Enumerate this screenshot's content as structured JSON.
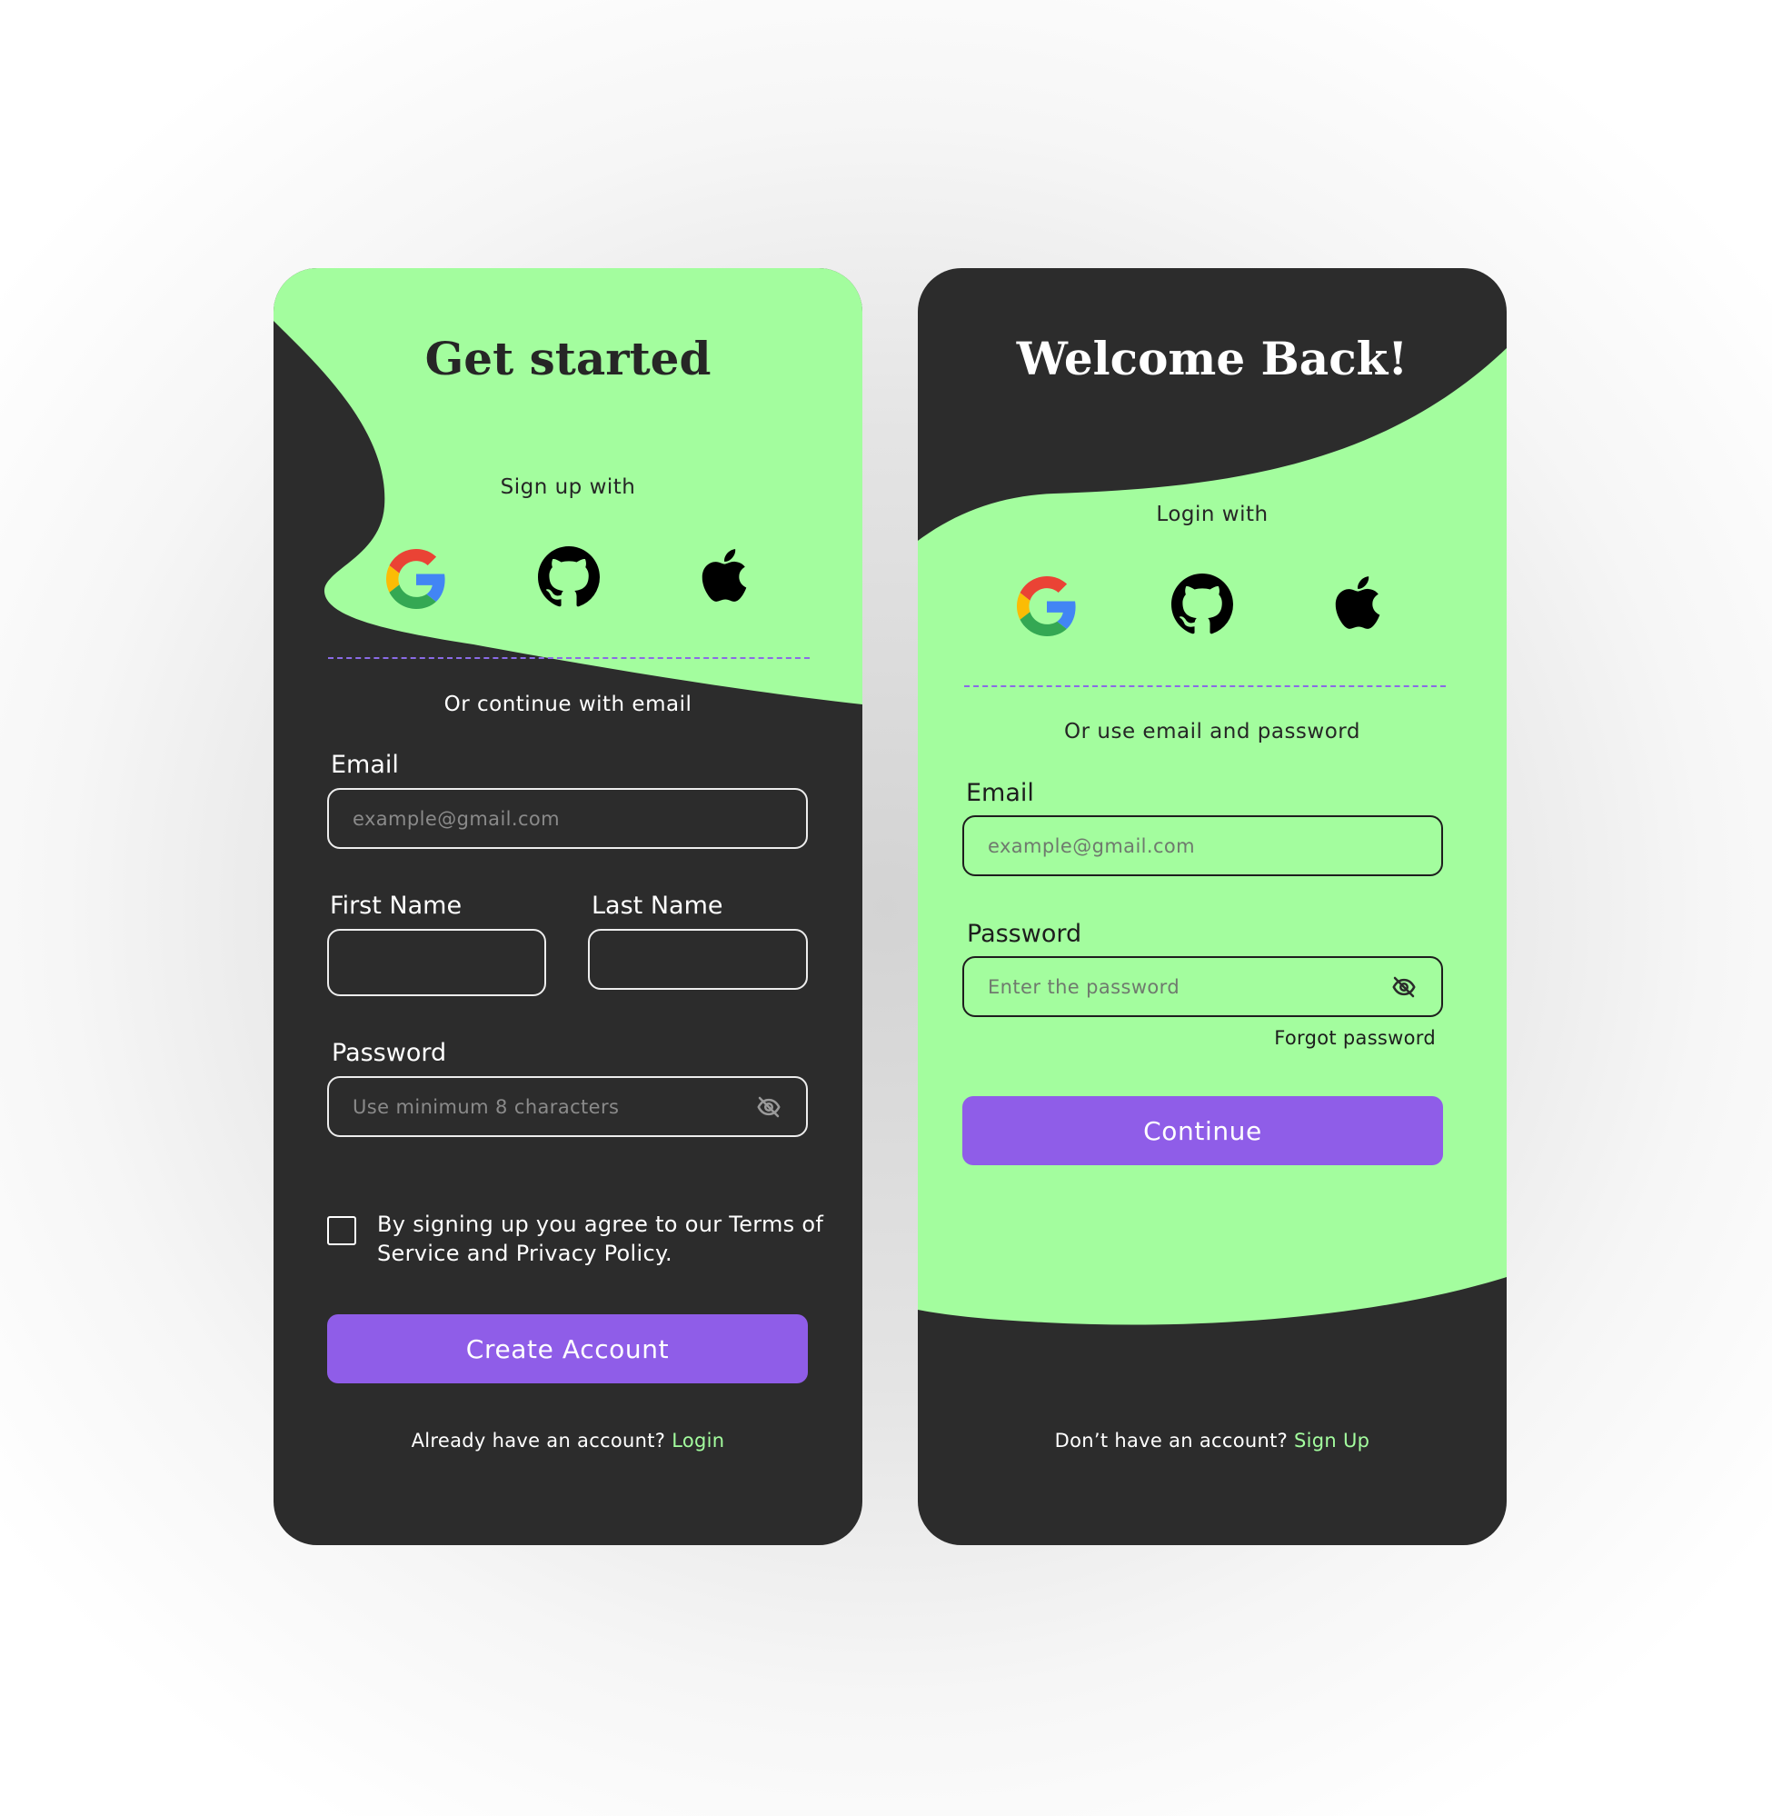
{
  "colors": {
    "dark": "#2c2c2c",
    "green": "#a3fd9e",
    "purple": "#8f5de8"
  },
  "signup": {
    "title": "Get started",
    "social_label": "Sign up with",
    "social_icons": [
      "google-icon",
      "github-icon",
      "apple-icon"
    ],
    "divider_text": "Or continue with email",
    "email_label": "Email",
    "email_placeholder": "example@gmail.com",
    "first_name_label": "First Name",
    "last_name_label": "Last Name",
    "password_label": "Password",
    "password_placeholder": "Use minimum 8 characters",
    "terms_line1": "By signing up you agree to our Terms of",
    "terms_line2": "Service and Privacy Policy.",
    "button": "Create Account",
    "footer_text": "Already have an account?",
    "footer_link": "Login"
  },
  "login": {
    "title": "Welcome Back!",
    "social_label": "Login with",
    "social_icons": [
      "google-icon",
      "github-icon",
      "apple-icon"
    ],
    "divider_text": "Or use email and password",
    "email_label": "Email",
    "email_placeholder": "example@gmail.com",
    "password_label": "Password",
    "password_placeholder": "Enter the password",
    "forgot": "Forgot password",
    "button": "Continue",
    "footer_text": "Don’t have an account?",
    "footer_link": "Sign Up"
  }
}
